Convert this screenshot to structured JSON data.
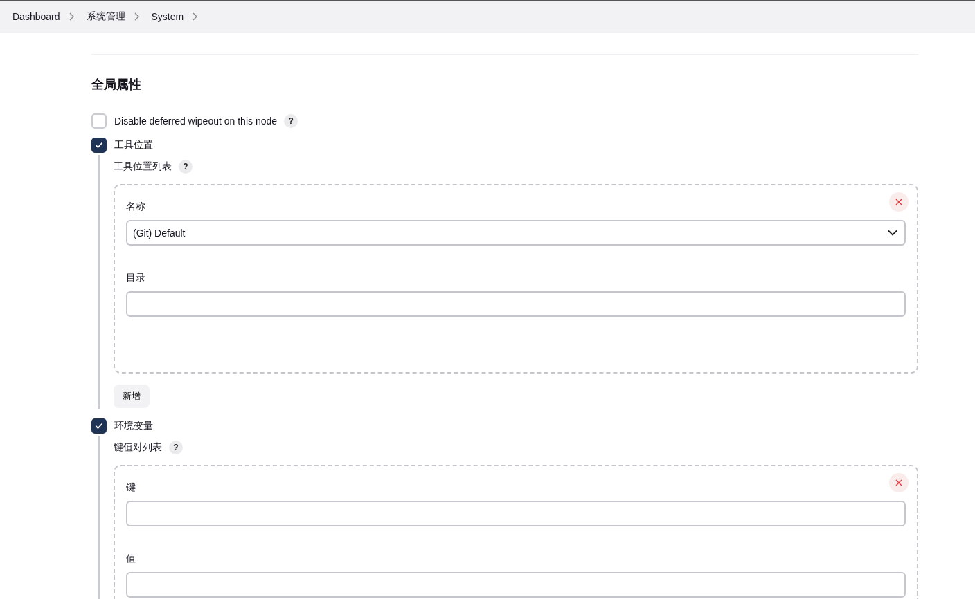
{
  "breadcrumb": [
    "Dashboard",
    "系统管理",
    "System"
  ],
  "section_title": "全局属性",
  "options": [
    {
      "kind": "checkbox",
      "label": "Disable deferred wipeout on this node",
      "checked": false,
      "help": "?"
    },
    {
      "kind": "checkbox",
      "label": "工具位置",
      "checked": true,
      "sub": {
        "list_label": "工具位置列表",
        "help": "?",
        "entries": [
          {
            "fields": [
              {
                "kind": "select",
                "label": "名称",
                "value": "(Git) Default"
              },
              {
                "kind": "text",
                "label": "目录"
              }
            ]
          }
        ],
        "add_button": "新增"
      }
    },
    {
      "kind": "checkbox",
      "label": "环境变量",
      "checked": true,
      "sub": {
        "list_label": "键值对列表",
        "help": "?",
        "entries": [
          {
            "fields": [
              {
                "kind": "text",
                "label": "键"
              },
              {
                "kind": "text",
                "label": "值"
              }
            ]
          }
        ]
      }
    }
  ]
}
